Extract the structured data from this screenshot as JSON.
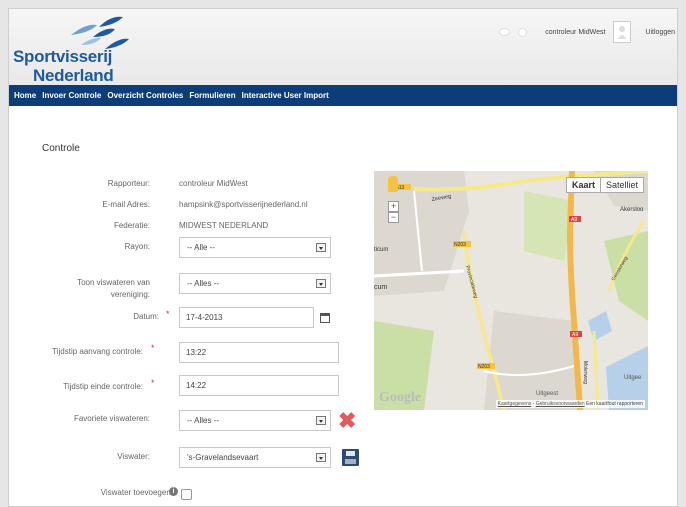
{
  "header": {
    "logo_line1": "Sportvisserij",
    "logo_line2": "Nederland",
    "user_name": "controleur MidWest",
    "logout": "Uitloggen"
  },
  "nav": {
    "items": [
      {
        "label": "Home"
      },
      {
        "label": "Invoer Controle"
      },
      {
        "label": "Overzicht Controles"
      },
      {
        "label": "Formulieren"
      },
      {
        "label": "Interactive User Import"
      }
    ]
  },
  "form": {
    "title": "Controle",
    "rapporteur_label": "Rapporteur:",
    "rapporteur_value": "controleur MidWest",
    "email_label": "E-mail Adres:",
    "email_value": "hampsink@sportvisserijnederland.nl",
    "federatie_label": "Federatie:",
    "federatie_value": "MIDWEST NEDERLAND",
    "rayon_label": "Rayon:",
    "rayon_value": "-- Alle --",
    "toon_label_1": "Toon viswateren van",
    "toon_label_2": "vereniging:",
    "toon_value": "-- Alles --",
    "datum_label": "Datum:",
    "datum_value": "17-4-2013",
    "tijdstip_aanvang_label": "Tijdstip aanvang controle:",
    "tijdstip_aanvang_value": "13:22",
    "tijdstip_einde_label": "Tijdstip einde controle:",
    "tijdstip_einde_value": "14:22",
    "favoriete_label": "Favoriete viswateren:",
    "favoriete_value": "-- Alles --",
    "viswater_label": "Viswater:",
    "viswater_value": "'s-Gravelandsevaart",
    "toevoegen_label": "Viswater toevoegen:",
    "required_mark": "*"
  },
  "map": {
    "btn_map": "Kaart",
    "btn_satellite": "Satelliet",
    "google": "Google",
    "footer_data": "Kaartgegevens",
    "footer_terms": "Gebruiksvoorwaarden",
    "footer_report": "Een kaartfout rapporteren",
    "labels": {
      "a": "513",
      "zeeweg": "Zeeweg",
      "n203_1": "N203",
      "n203_2": "N203",
      "a9_1": "A9",
      "a9_2": "A9",
      "akersloot": "Akersloo",
      "castricum": "ticum",
      "um": "cum",
      "uitgeest": "Uitgeest",
      "uitgee": "Uitgee",
      "zeestraat": "Geesterweg",
      "provinciale": "Provincialeweg",
      "a_rd": "Beverwijk",
      "molenweg": "Molenweg"
    },
    "colors": {
      "water": "#b5d0e8",
      "green": "#c9dfa6",
      "urban": "#dcd8d0",
      "motorway": "#f2b84b",
      "road": "#f7e98a"
    }
  }
}
